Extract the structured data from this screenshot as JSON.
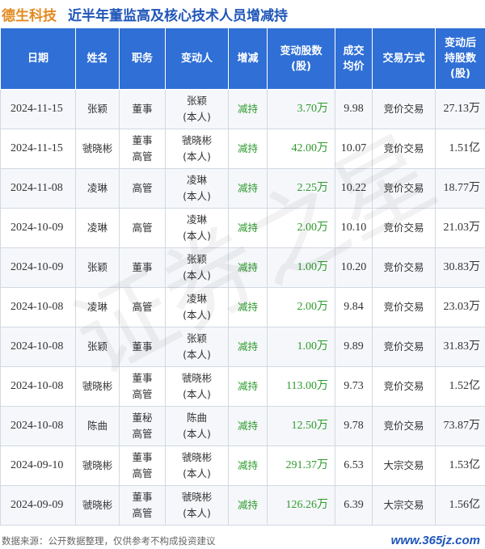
{
  "header": {
    "company": "德生科技",
    "title": "近半年董监高及核心技术人员增减持"
  },
  "table": {
    "columns": [
      {
        "key": "date",
        "lines": [
          "日期"
        ]
      },
      {
        "key": "name",
        "lines": [
          "姓名"
        ]
      },
      {
        "key": "position",
        "lines": [
          "职务"
        ]
      },
      {
        "key": "changer",
        "lines": [
          "变动人"
        ]
      },
      {
        "key": "direction",
        "lines": [
          "增减"
        ]
      },
      {
        "key": "quantity",
        "lines": [
          "变动股数",
          "(股)"
        ]
      },
      {
        "key": "avg_price",
        "lines": [
          "成交",
          "均价"
        ]
      },
      {
        "key": "method",
        "lines": [
          "交易方式"
        ]
      },
      {
        "key": "after",
        "lines": [
          "变动后",
          "持股数",
          "(股)"
        ]
      }
    ],
    "rows": [
      {
        "date": "2024-11-15",
        "name": "张颖",
        "position": [
          "董事"
        ],
        "changer": [
          "张颖",
          "(本人)"
        ],
        "direction": "减持",
        "quantity": "3.70万",
        "avg_price": "9.98",
        "method": "竞价交易",
        "after": "27.13万"
      },
      {
        "date": "2024-11-15",
        "name": "虢晓彬",
        "position": [
          "董事",
          "高管"
        ],
        "changer": [
          "虢晓彬",
          "(本人)"
        ],
        "direction": "减持",
        "quantity": "42.00万",
        "avg_price": "10.07",
        "method": "竞价交易",
        "after": "1.51亿"
      },
      {
        "date": "2024-11-08",
        "name": "凌琳",
        "position": [
          "高管"
        ],
        "changer": [
          "凌琳",
          "(本人)"
        ],
        "direction": "减持",
        "quantity": "2.25万",
        "avg_price": "10.22",
        "method": "竞价交易",
        "after": "18.77万"
      },
      {
        "date": "2024-10-09",
        "name": "凌琳",
        "position": [
          "高管"
        ],
        "changer": [
          "凌琳",
          "(本人)"
        ],
        "direction": "减持",
        "quantity": "2.00万",
        "avg_price": "10.10",
        "method": "竞价交易",
        "after": "21.03万"
      },
      {
        "date": "2024-10-09",
        "name": "张颖",
        "position": [
          "董事"
        ],
        "changer": [
          "张颖",
          "(本人)"
        ],
        "direction": "减持",
        "quantity": "1.00万",
        "avg_price": "10.20",
        "method": "竞价交易",
        "after": "30.83万"
      },
      {
        "date": "2024-10-08",
        "name": "凌琳",
        "position": [
          "高管"
        ],
        "changer": [
          "凌琳",
          "(本人)"
        ],
        "direction": "减持",
        "quantity": "2.00万",
        "avg_price": "9.84",
        "method": "竞价交易",
        "after": "23.03万"
      },
      {
        "date": "2024-10-08",
        "name": "张颖",
        "position": [
          "董事"
        ],
        "changer": [
          "张颖",
          "(本人)"
        ],
        "direction": "减持",
        "quantity": "1.00万",
        "avg_price": "9.89",
        "method": "竞价交易",
        "after": "31.83万"
      },
      {
        "date": "2024-10-08",
        "name": "虢晓彬",
        "position": [
          "董事",
          "高管"
        ],
        "changer": [
          "虢晓彬",
          "(本人)"
        ],
        "direction": "减持",
        "quantity": "113.00万",
        "avg_price": "9.73",
        "method": "竞价交易",
        "after": "1.52亿"
      },
      {
        "date": "2024-10-08",
        "name": "陈曲",
        "position": [
          "董秘",
          "高管"
        ],
        "changer": [
          "陈曲",
          "(本人)"
        ],
        "direction": "减持",
        "quantity": "12.50万",
        "avg_price": "9.78",
        "method": "竞价交易",
        "after": "73.87万"
      },
      {
        "date": "2024-09-10",
        "name": "虢晓彬",
        "position": [
          "董事",
          "高管"
        ],
        "changer": [
          "虢晓彬",
          "(本人)"
        ],
        "direction": "减持",
        "quantity": "291.37万",
        "avg_price": "6.53",
        "method": "大宗交易",
        "after": "1.53亿"
      },
      {
        "date": "2024-09-09",
        "name": "虢晓彬",
        "position": [
          "董事",
          "高管"
        ],
        "changer": [
          "虢晓彬",
          "(本人)"
        ],
        "direction": "减持",
        "quantity": "126.26万",
        "avg_price": "6.39",
        "method": "大宗交易",
        "after": "1.56亿"
      }
    ]
  },
  "footer": {
    "source": "数据来源：公开数据整理，仅供参考不构成投资建议",
    "site": "www.365jz.com"
  },
  "watermark": "证券之星",
  "colors": {
    "company": "#e28a1f",
    "title": "#1f56b8",
    "header_bg": "#2f6fd6",
    "decrease": "#2e9b2e"
  }
}
